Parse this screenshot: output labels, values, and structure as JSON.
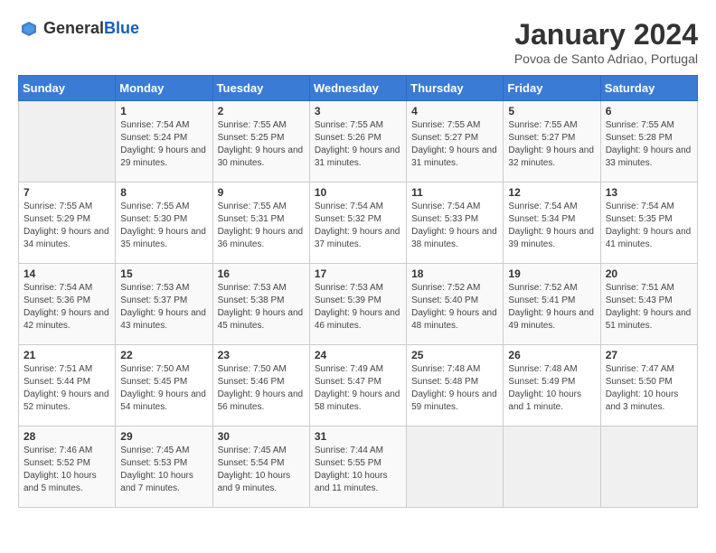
{
  "header": {
    "logo_general": "General",
    "logo_blue": "Blue",
    "month_title": "January 2024",
    "location": "Povoa de Santo Adriao, Portugal"
  },
  "days_of_week": [
    "Sunday",
    "Monday",
    "Tuesday",
    "Wednesday",
    "Thursday",
    "Friday",
    "Saturday"
  ],
  "weeks": [
    [
      {
        "day": "",
        "sunrise": "",
        "sunset": "",
        "daylight": ""
      },
      {
        "day": "1",
        "sunrise": "Sunrise: 7:54 AM",
        "sunset": "Sunset: 5:24 PM",
        "daylight": "Daylight: 9 hours and 29 minutes."
      },
      {
        "day": "2",
        "sunrise": "Sunrise: 7:55 AM",
        "sunset": "Sunset: 5:25 PM",
        "daylight": "Daylight: 9 hours and 30 minutes."
      },
      {
        "day": "3",
        "sunrise": "Sunrise: 7:55 AM",
        "sunset": "Sunset: 5:26 PM",
        "daylight": "Daylight: 9 hours and 31 minutes."
      },
      {
        "day": "4",
        "sunrise": "Sunrise: 7:55 AM",
        "sunset": "Sunset: 5:27 PM",
        "daylight": "Daylight: 9 hours and 31 minutes."
      },
      {
        "day": "5",
        "sunrise": "Sunrise: 7:55 AM",
        "sunset": "Sunset: 5:27 PM",
        "daylight": "Daylight: 9 hours and 32 minutes."
      },
      {
        "day": "6",
        "sunrise": "Sunrise: 7:55 AM",
        "sunset": "Sunset: 5:28 PM",
        "daylight": "Daylight: 9 hours and 33 minutes."
      }
    ],
    [
      {
        "day": "7",
        "sunrise": "Sunrise: 7:55 AM",
        "sunset": "Sunset: 5:29 PM",
        "daylight": "Daylight: 9 hours and 34 minutes."
      },
      {
        "day": "8",
        "sunrise": "Sunrise: 7:55 AM",
        "sunset": "Sunset: 5:30 PM",
        "daylight": "Daylight: 9 hours and 35 minutes."
      },
      {
        "day": "9",
        "sunrise": "Sunrise: 7:55 AM",
        "sunset": "Sunset: 5:31 PM",
        "daylight": "Daylight: 9 hours and 36 minutes."
      },
      {
        "day": "10",
        "sunrise": "Sunrise: 7:54 AM",
        "sunset": "Sunset: 5:32 PM",
        "daylight": "Daylight: 9 hours and 37 minutes."
      },
      {
        "day": "11",
        "sunrise": "Sunrise: 7:54 AM",
        "sunset": "Sunset: 5:33 PM",
        "daylight": "Daylight: 9 hours and 38 minutes."
      },
      {
        "day": "12",
        "sunrise": "Sunrise: 7:54 AM",
        "sunset": "Sunset: 5:34 PM",
        "daylight": "Daylight: 9 hours and 39 minutes."
      },
      {
        "day": "13",
        "sunrise": "Sunrise: 7:54 AM",
        "sunset": "Sunset: 5:35 PM",
        "daylight": "Daylight: 9 hours and 41 minutes."
      }
    ],
    [
      {
        "day": "14",
        "sunrise": "Sunrise: 7:54 AM",
        "sunset": "Sunset: 5:36 PM",
        "daylight": "Daylight: 9 hours and 42 minutes."
      },
      {
        "day": "15",
        "sunrise": "Sunrise: 7:53 AM",
        "sunset": "Sunset: 5:37 PM",
        "daylight": "Daylight: 9 hours and 43 minutes."
      },
      {
        "day": "16",
        "sunrise": "Sunrise: 7:53 AM",
        "sunset": "Sunset: 5:38 PM",
        "daylight": "Daylight: 9 hours and 45 minutes."
      },
      {
        "day": "17",
        "sunrise": "Sunrise: 7:53 AM",
        "sunset": "Sunset: 5:39 PM",
        "daylight": "Daylight: 9 hours and 46 minutes."
      },
      {
        "day": "18",
        "sunrise": "Sunrise: 7:52 AM",
        "sunset": "Sunset: 5:40 PM",
        "daylight": "Daylight: 9 hours and 48 minutes."
      },
      {
        "day": "19",
        "sunrise": "Sunrise: 7:52 AM",
        "sunset": "Sunset: 5:41 PM",
        "daylight": "Daylight: 9 hours and 49 minutes."
      },
      {
        "day": "20",
        "sunrise": "Sunrise: 7:51 AM",
        "sunset": "Sunset: 5:43 PM",
        "daylight": "Daylight: 9 hours and 51 minutes."
      }
    ],
    [
      {
        "day": "21",
        "sunrise": "Sunrise: 7:51 AM",
        "sunset": "Sunset: 5:44 PM",
        "daylight": "Daylight: 9 hours and 52 minutes."
      },
      {
        "day": "22",
        "sunrise": "Sunrise: 7:50 AM",
        "sunset": "Sunset: 5:45 PM",
        "daylight": "Daylight: 9 hours and 54 minutes."
      },
      {
        "day": "23",
        "sunrise": "Sunrise: 7:50 AM",
        "sunset": "Sunset: 5:46 PM",
        "daylight": "Daylight: 9 hours and 56 minutes."
      },
      {
        "day": "24",
        "sunrise": "Sunrise: 7:49 AM",
        "sunset": "Sunset: 5:47 PM",
        "daylight": "Daylight: 9 hours and 58 minutes."
      },
      {
        "day": "25",
        "sunrise": "Sunrise: 7:48 AM",
        "sunset": "Sunset: 5:48 PM",
        "daylight": "Daylight: 9 hours and 59 minutes."
      },
      {
        "day": "26",
        "sunrise": "Sunrise: 7:48 AM",
        "sunset": "Sunset: 5:49 PM",
        "daylight": "Daylight: 10 hours and 1 minute."
      },
      {
        "day": "27",
        "sunrise": "Sunrise: 7:47 AM",
        "sunset": "Sunset: 5:50 PM",
        "daylight": "Daylight: 10 hours and 3 minutes."
      }
    ],
    [
      {
        "day": "28",
        "sunrise": "Sunrise: 7:46 AM",
        "sunset": "Sunset: 5:52 PM",
        "daylight": "Daylight: 10 hours and 5 minutes."
      },
      {
        "day": "29",
        "sunrise": "Sunrise: 7:45 AM",
        "sunset": "Sunset: 5:53 PM",
        "daylight": "Daylight: 10 hours and 7 minutes."
      },
      {
        "day": "30",
        "sunrise": "Sunrise: 7:45 AM",
        "sunset": "Sunset: 5:54 PM",
        "daylight": "Daylight: 10 hours and 9 minutes."
      },
      {
        "day": "31",
        "sunrise": "Sunrise: 7:44 AM",
        "sunset": "Sunset: 5:55 PM",
        "daylight": "Daylight: 10 hours and 11 minutes."
      },
      {
        "day": "",
        "sunrise": "",
        "sunset": "",
        "daylight": ""
      },
      {
        "day": "",
        "sunrise": "",
        "sunset": "",
        "daylight": ""
      },
      {
        "day": "",
        "sunrise": "",
        "sunset": "",
        "daylight": ""
      }
    ]
  ]
}
